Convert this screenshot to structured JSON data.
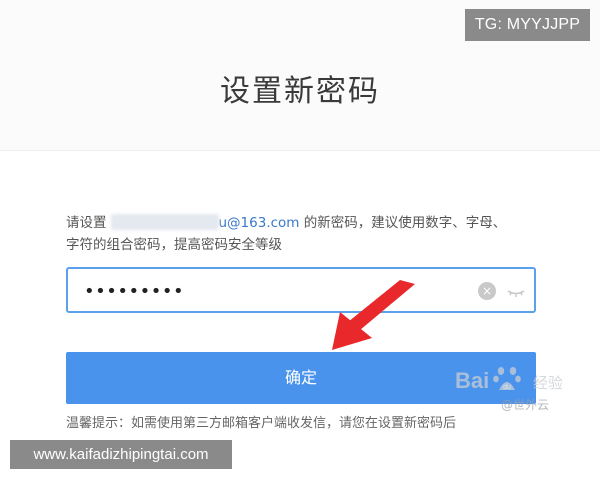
{
  "overlay": {
    "tg_label": "TG: MYYJJPP",
    "url_label": "www.kaifadizhipingtai.com"
  },
  "page": {
    "title": "设置新密码",
    "instructions": {
      "prefix": "请设置",
      "email_visible": "u@163.com",
      "suffix": " 的新密码，建议使用数字、字母、",
      "line2": "字符的组合密码，提高密码安全等级"
    },
    "password_field": {
      "value": "•••••••••"
    },
    "confirm_button": {
      "label": "确定"
    },
    "tip": "温馨提示：如需使用第三方邮箱客户端收发信，请您在设置新密码后"
  },
  "watermark": {
    "logo_text": "Bai",
    "logo_suffix": "经验",
    "author": "@世外云"
  },
  "icons": {
    "clear": "clear-icon",
    "eye": "eye-icon",
    "arrow": "red-arrow-annotation"
  },
  "colors": {
    "accent": "#4a93ec",
    "field_border": "#5aa0ea",
    "arrow": "#e8282a",
    "badge_bg": "#8a8a8a"
  }
}
